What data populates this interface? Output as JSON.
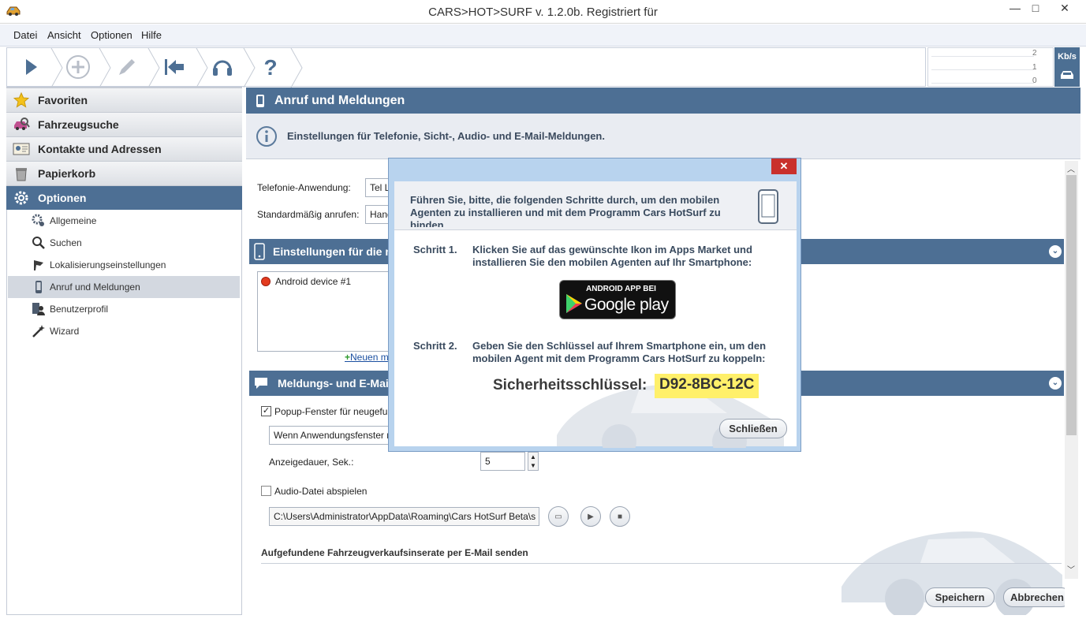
{
  "window": {
    "title": "CARS>HOT>SURF v. 1.2.0b. Registriert für",
    "minimize": "—",
    "maximize": "□",
    "close": "✕"
  },
  "menu": [
    "Datei",
    "Ansicht",
    "Optionen",
    "Hilfe"
  ],
  "toolbar": {
    "buttons": [
      "play-icon",
      "add-icon",
      "edit-icon",
      "back-to-start-icon",
      "headset-icon",
      "help-icon"
    ],
    "help_glyph": "?"
  },
  "speed": {
    "ticks": [
      "2",
      "1",
      "0"
    ],
    "unit": "Kb/s"
  },
  "sidebar": {
    "sections": [
      {
        "label": "Favoriten",
        "icon": "star-icon"
      },
      {
        "label": "Fahrzeugsuche",
        "icon": "car-search-icon"
      },
      {
        "label": "Kontakte und Adressen",
        "icon": "contacts-icon"
      },
      {
        "label": "Papierkorb",
        "icon": "trash-icon"
      },
      {
        "label": "Optionen",
        "icon": "gear-icon"
      }
    ],
    "subitems": [
      {
        "label": "Allgemeine",
        "icon": "gears-icon"
      },
      {
        "label": "Suchen",
        "icon": "search-icon"
      },
      {
        "label": "Lokalisierungseinstellungen",
        "icon": "flag-icon"
      },
      {
        "label": "Anruf und Meldungen",
        "icon": "phone-icon"
      },
      {
        "label": "Benutzerprofil",
        "icon": "user-profile-icon"
      },
      {
        "label": "Wizard",
        "icon": "wizard-icon"
      }
    ]
  },
  "main": {
    "title": "Anruf und Meldungen",
    "info": "Einstellungen für Telefonie, Sicht-, Audio- und E-Mail-Meldungen.",
    "telephony_label": "Telefonie-Anwendung:",
    "telephony_value": "Tel L",
    "default_call_label": "Standardmäßig anrufen:",
    "default_call_value": "Hand",
    "group1_title": "Einstellungen für die m",
    "device": "Android device #1",
    "new_link": "Neuen m",
    "group2_title": "Meldungs- und E-Mail-",
    "popup_label": "Popup-Fenster für neugefu",
    "popup_select": "Wenn Anwendungsfenster n",
    "duration_label": "Anzeigedauer, Sek.:",
    "duration_value": "5",
    "audio_label": "Audio-Datei abspielen",
    "audio_path": "C:\\Users\\Administrator\\AppData\\Roaming\\Cars HotSurf Beta\\s",
    "email_section": "Aufgefundene Fahrzeugverkaufsinserate per E-Mail senden",
    "save": "Speichern",
    "cancel": "Abbrechen"
  },
  "dialog": {
    "close": "✕",
    "intro": "Führen Sie, bitte, die folgenden Schritte durch, um den mobilen Agenten zu installieren und mit dem Programm Cars HotSurf zu binden.",
    "step1_label": "Schritt 1.",
    "step1_text": "Klicken Sie auf das gewünschte Ikon im Apps Market und installieren Sie den mobilen Agenten auf Ihr Smartphone:",
    "badge_top": "ANDROID APP BEI",
    "badge_main": "Google play",
    "step2_label": "Schritt 2.",
    "step2_text": "Geben Sie den Schlüssel auf Ihrem Smartphone ein, um den mobilen Agent mit dem Programm Cars HotSurf zu koppeln:",
    "key_label": "Sicherheitsschlüssel:",
    "key_value": "D92-8BC-12C",
    "close_button": "Schließen"
  },
  "colors": {
    "accent": "#4d6f94",
    "key_highlight": "#fff06a",
    "dialog_frame": "#b8d3ee",
    "close_red": "#c9302c"
  }
}
